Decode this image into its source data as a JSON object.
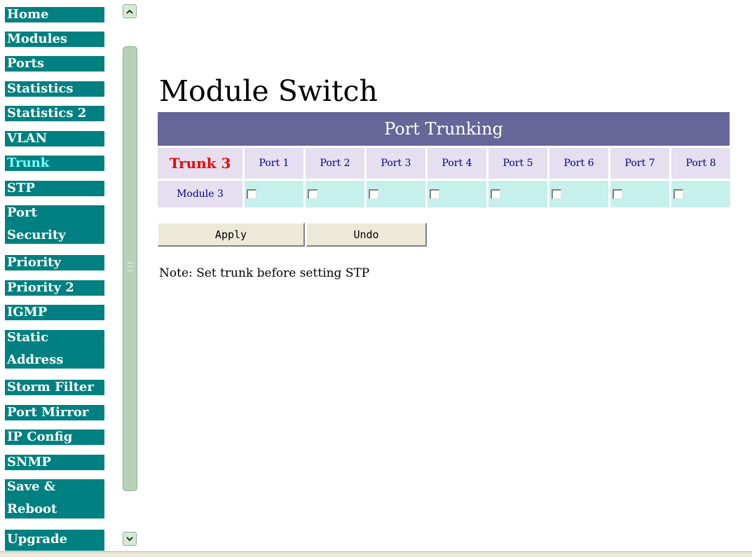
{
  "nav": {
    "items": [
      {
        "label": "Home"
      },
      {
        "label": "Modules"
      },
      {
        "label": "Ports"
      },
      {
        "label": "Statistics"
      },
      {
        "label": "Statistics 2"
      },
      {
        "label": "VLAN"
      },
      {
        "label": "Trunk"
      },
      {
        "label": "STP"
      },
      {
        "label": "Port"
      },
      {
        "label": "Security"
      },
      {
        "label": "Priority"
      },
      {
        "label": "Priority 2"
      },
      {
        "label": "IGMP"
      },
      {
        "label": "Static"
      },
      {
        "label": "Address"
      },
      {
        "label": "Storm Filter"
      },
      {
        "label": "Port Mirror"
      },
      {
        "label": "IP Config"
      },
      {
        "label": "SNMP"
      },
      {
        "label": "Save &"
      },
      {
        "label": "Reboot"
      },
      {
        "label": "Upgrade"
      }
    ],
    "active": "Trunk"
  },
  "page": {
    "title": "Module Switch",
    "table_header": "Port Trunking",
    "trunk_label": "Trunk 3",
    "ports": [
      "Port 1",
      "Port 2",
      "Port 3",
      "Port 4",
      "Port 5",
      "Port 6",
      "Port 7",
      "Port 8"
    ],
    "module_label": "Module 3",
    "checked": [
      false,
      false,
      false,
      false,
      false,
      false,
      false,
      false
    ],
    "apply_label": "Apply",
    "undo_label": "Undo",
    "note": "Note: Set trunk before setting STP"
  },
  "colors": {
    "nav_bg": "#008080",
    "nav_active_text": "#7fffff",
    "header_bg": "#666699",
    "label_cell_bg": "#e6dff0",
    "checkbox_cell_bg": "#c6f0ec",
    "trunk_text": "#ee0000"
  },
  "icons": {
    "scroll_up": "chevron-up-icon",
    "scroll_down": "chevron-down-icon"
  }
}
